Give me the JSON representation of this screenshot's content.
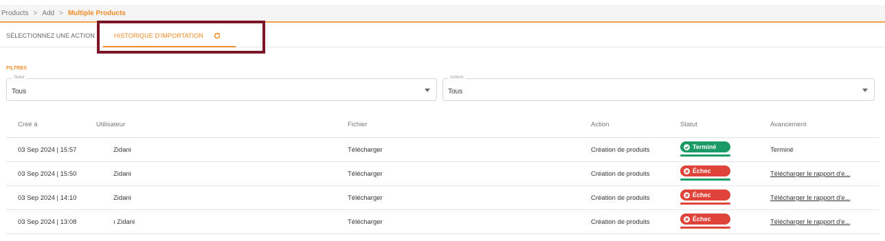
{
  "breadcrumb": {
    "items": [
      "Products",
      "Add"
    ],
    "current": "Multiple Products"
  },
  "tabs": {
    "select_action": "SÉLECTIONNEZ UNE ACTION",
    "import_history": "HISTORIQUE D'IMPORTATION"
  },
  "filters": {
    "title": "FILTRES",
    "status": {
      "label": "Statut",
      "value": "Tous"
    },
    "actions": {
      "label": "Actions",
      "value": "Tous"
    }
  },
  "table": {
    "headers": [
      "Créé à",
      "Utilisateur",
      "Fichier",
      "Action",
      "Statut",
      "Avancement"
    ],
    "rows": [
      {
        "created": "03 Sep 2024 | 15:57",
        "user": "Zidani",
        "file": "Télécharger",
        "action": "Création de produits",
        "status": "Terminé",
        "progress": "Terminé"
      },
      {
        "created": "03 Sep 2024 | 15:50",
        "user": "Zidani",
        "file": "Télécharger",
        "action": "Création de produits",
        "status": "Échec",
        "progress": "Télécharger le rapport d'e..."
      },
      {
        "created": "03 Sep 2024 | 14:10",
        "user": "Zidani",
        "file": "Télécharger",
        "action": "Création de produits",
        "status": "Échec",
        "progress": "Télécharger le rapport d'e..."
      },
      {
        "created": "03 Sep 2024 | 13:08",
        "user": "ı Zidani",
        "file": "Télécharger",
        "action": "Création de produits",
        "status": "Échec",
        "progress": "Télécharger le rapport d'e..."
      }
    ]
  },
  "colors": {
    "accent": "#f08a24",
    "success": "#1a9a64",
    "danger": "#e0433a",
    "highlight": "#7b1426"
  },
  "icons": {
    "refresh": "refresh-icon",
    "success": "check-circle-icon",
    "error": "x-circle-icon",
    "caret": "caret-down-icon"
  }
}
